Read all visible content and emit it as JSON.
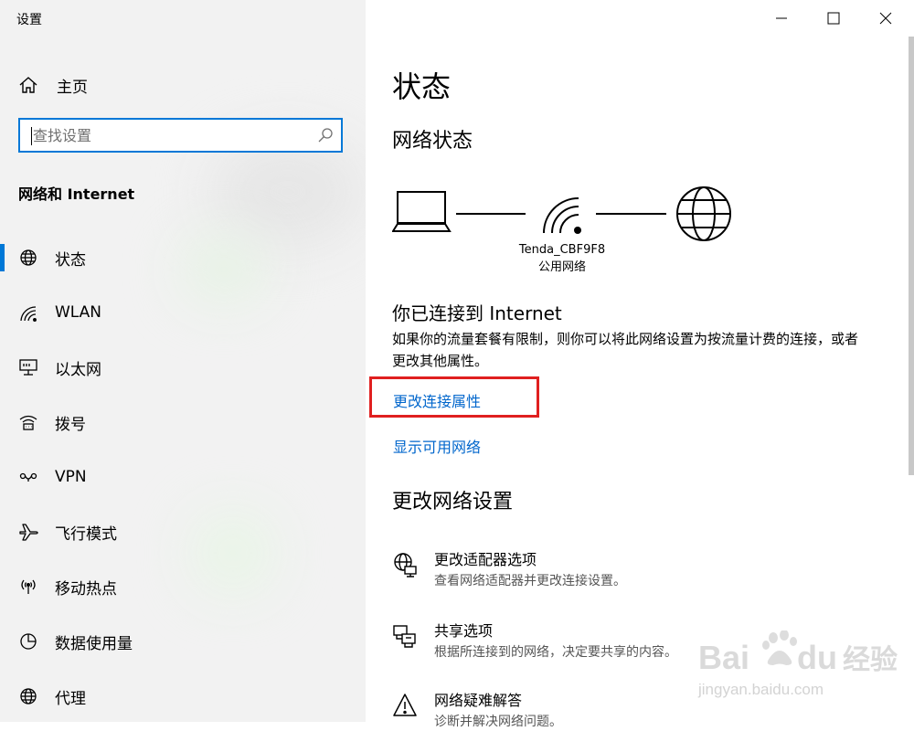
{
  "window": {
    "title": "设置"
  },
  "sidebar": {
    "home_label": "主页",
    "search_placeholder": "查找设置",
    "section_title": "网络和 Internet",
    "items": [
      {
        "label": "状态",
        "icon": "globe-icon",
        "selected": true
      },
      {
        "label": "WLAN",
        "icon": "wifi-icon",
        "selected": false
      },
      {
        "label": "以太网",
        "icon": "ethernet-icon",
        "selected": false
      },
      {
        "label": "拨号",
        "icon": "dialup-icon",
        "selected": false
      },
      {
        "label": "VPN",
        "icon": "vpn-icon",
        "selected": false
      },
      {
        "label": "飞行模式",
        "icon": "airplane-icon",
        "selected": false
      },
      {
        "label": "移动热点",
        "icon": "hotspot-icon",
        "selected": false
      },
      {
        "label": "数据使用量",
        "icon": "data-usage-icon",
        "selected": false
      },
      {
        "label": "代理",
        "icon": "globe-icon",
        "selected": false
      }
    ]
  },
  "main": {
    "title": "状态",
    "network_status_heading": "网络状态",
    "network": {
      "ssid": "Tenda_CBF9F8",
      "type": "公用网络"
    },
    "connected_heading": "你已连接到 Internet",
    "description": "如果你的流量套餐有限制，则你可以将此网络设置为按流量计费的连接，或者更改其他属性。",
    "links": {
      "change_properties": "更改连接属性",
      "show_networks": "显示可用网络"
    },
    "change_settings_heading": "更改网络设置",
    "settings": [
      {
        "title": "更改适配器选项",
        "description": "查看网络适配器并更改连接设置。",
        "icon": "adapter-icon"
      },
      {
        "title": "共享选项",
        "description": "根据所连接到的网络，决定要共享的内容。",
        "icon": "sharing-icon"
      },
      {
        "title": "网络疑难解答",
        "description": "诊断并解决网络问题。",
        "icon": "warning-icon"
      }
    ]
  },
  "watermark": {
    "brand": "Baidu 经验",
    "url": "jingyan.baidu.com"
  },
  "colors": {
    "accent": "#0078d7",
    "link": "#0066cc",
    "highlight_border": "#e02020",
    "sidebar_bg": "#f2f2f2"
  }
}
